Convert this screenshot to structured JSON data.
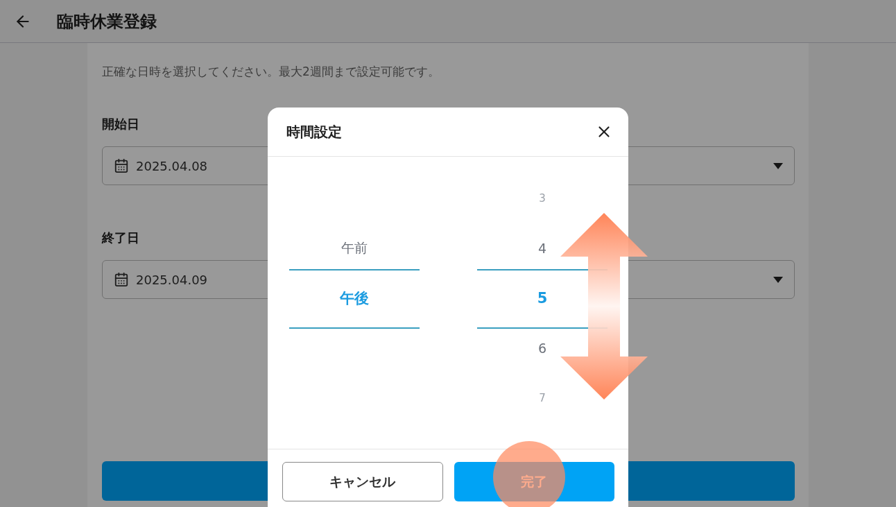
{
  "header": {
    "title": "臨時休業登録"
  },
  "description": "正確な日時を選択してください。最大2週間まで設定可能です。",
  "fields": [
    {
      "label": "開始日",
      "value": "2025.04.08"
    },
    {
      "label": "終了日",
      "value": "2025.04.09"
    }
  ],
  "dialog": {
    "title": "時間設定",
    "periods": [
      {
        "label": "午前",
        "selected": false
      },
      {
        "label": "午後",
        "selected": true
      }
    ],
    "hours": [
      {
        "label": "3",
        "selected": false
      },
      {
        "label": "4",
        "selected": false
      },
      {
        "label": "5",
        "selected": true
      },
      {
        "label": "6",
        "selected": false
      },
      {
        "label": "7",
        "selected": false
      }
    ],
    "buttons": [
      {
        "label": "キャンセル",
        "kind": "secondary"
      },
      {
        "label": "完了",
        "kind": "primary"
      }
    ]
  }
}
